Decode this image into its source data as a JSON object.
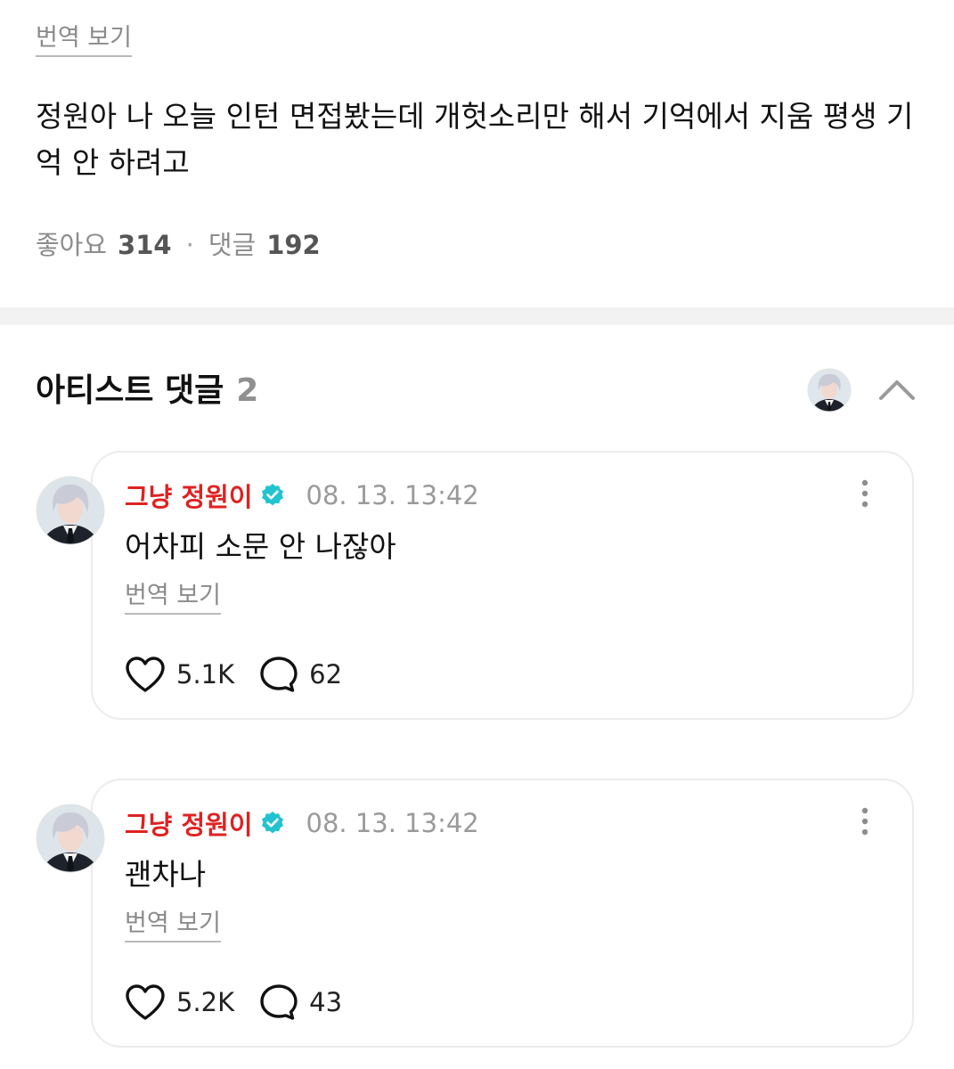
{
  "post": {
    "translate_label": "번역 보기",
    "body": "정원아 나 오늘 인턴 면접봤는데 개헛소리만 해서 기억에서 지움 평생 기억 안 하려고",
    "likes_label": "좋아요",
    "likes_count": "314",
    "separator": "·",
    "comments_label": "댓글",
    "comments_count": "192"
  },
  "artist_section": {
    "title": "아티스트 댓글",
    "count": "2"
  },
  "colors": {
    "author": "#e02121",
    "verified": "#22c3cf",
    "muted": "#8a8a8a",
    "divider": "#f2f2f2"
  },
  "icons": {
    "verified": "verified-badge-icon",
    "more": "more-vertical-icon",
    "like": "heart-icon",
    "reply": "speech-bubble-icon",
    "collapse": "chevron-up-icon"
  },
  "comments": [
    {
      "author": "그냥 정원이",
      "time": "08. 13. 13:42",
      "text": "어차피 소문 안 나잖아",
      "translate_label": "번역 보기",
      "likes": "5.1K",
      "replies": "62"
    },
    {
      "author": "그냥 정원이",
      "time": "08. 13. 13:42",
      "text": "괜차나",
      "translate_label": "번역 보기",
      "likes": "5.2K",
      "replies": "43"
    }
  ]
}
